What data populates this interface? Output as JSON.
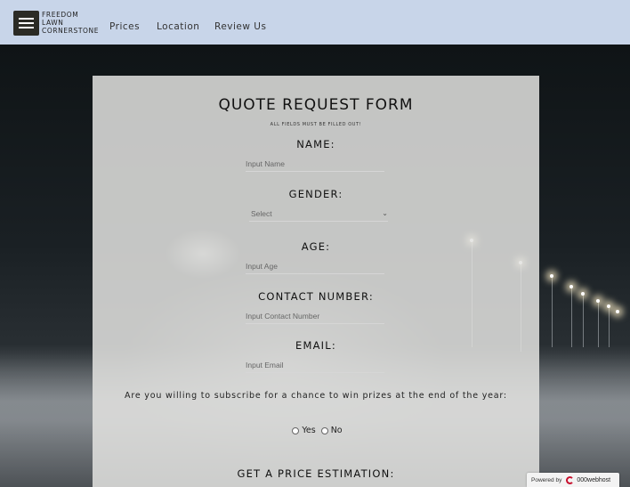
{
  "header": {
    "brand_lines": [
      "FREEDOM",
      "LAWN",
      "CORNERSTONE"
    ],
    "nav": [
      "Prices",
      "Location",
      "Review Us"
    ]
  },
  "form": {
    "title": "QUOTE REQUEST FORM",
    "subtitle": "ALL FIELDS MUST BE FILLED OUT!",
    "name_label": "NAME:",
    "name_placeholder": "Input Name",
    "gender_label": "GENDER:",
    "gender_selected": "Select",
    "age_label": "AGE:",
    "age_placeholder": "Input Age",
    "contact_label": "CONTACT NUMBER:",
    "contact_placeholder": "Input Contact Number",
    "email_label": "EMAIL:",
    "email_placeholder": "Input Email",
    "subscribe_question": "Are you willing to subscribe for a chance to win prizes at the end of the year:",
    "yes_label": "Yes",
    "no_label": "No",
    "estimation_label": "GET A PRICE ESTIMATION:"
  },
  "badge": {
    "powered_by": "Powered by",
    "host": "000webhost"
  }
}
